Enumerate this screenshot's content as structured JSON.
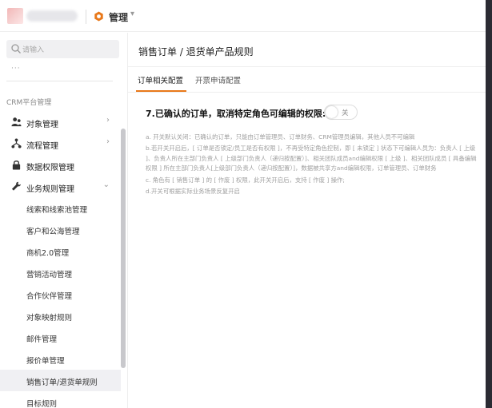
{
  "topbar": {
    "app_title": "管理",
    "brand_color": "#e8781a"
  },
  "sidebar": {
    "search_placeholder": "请输入",
    "dots": "···",
    "section_title": "CRM平台管理",
    "items": [
      {
        "label": "对象管理",
        "icon": "users-icon",
        "has_chevron": true
      },
      {
        "label": "流程管理",
        "icon": "flow-icon",
        "has_chevron": true
      },
      {
        "label": "数据权限管理",
        "icon": "lock-icon",
        "has_chevron": false
      },
      {
        "label": "业务规则管理",
        "icon": "wrench-icon",
        "has_chevron": true,
        "expanded": true
      }
    ],
    "sub_items": [
      {
        "label": "线索和线索池管理"
      },
      {
        "label": "客户和公海管理"
      },
      {
        "label": "商机2.0管理"
      },
      {
        "label": "营销活动管理"
      },
      {
        "label": "合作伙伴管理"
      },
      {
        "label": "对象映射规则"
      },
      {
        "label": "邮件管理"
      },
      {
        "label": "报价单管理"
      },
      {
        "label": "销售订单/退货单规则",
        "active": true
      },
      {
        "label": "目标规则"
      }
    ]
  },
  "main": {
    "page_title": "销售订单 / 退货单产品规则",
    "tabs": [
      {
        "label": "订单相关配置",
        "active": true
      },
      {
        "label": "开票申请配置",
        "active": false
      }
    ],
    "rule_title": "7.已确认的订单，取消特定角色可编辑的权限:",
    "toggle_label": "关",
    "toggle_on": false,
    "notes": [
      "a. 开关默认关闭：已确认的订单，只能由订单管理员、订单财务、CRM管理员编辑，其他人员不可编辑",
      "b.若开关开启后，[ 订单是否锁定/员工是否有权限 ]，不再受特定角色控制，即 [ 未锁定 ] 状态下可编辑人员为：负责人 [ 上级 ]、负责人所在主部门负责人 [ 上级部门负责人（递归按配置）]、相关团队成员and编辑权限 [ 上级 ]、相关团队成员 [ 具备编辑权限 ] 所在主部门负责人[上级部门负责人（递归按配置）]，数据被共享方and编辑权限，订单管理员、订单财务",
      "c. 角色有 [ 销售订单 ] 的 [ 作废 ] 权限，此开关开启后，支持 [ 作废 ] 操作;",
      "d.开关可根据实际业务场景反复开启"
    ]
  }
}
